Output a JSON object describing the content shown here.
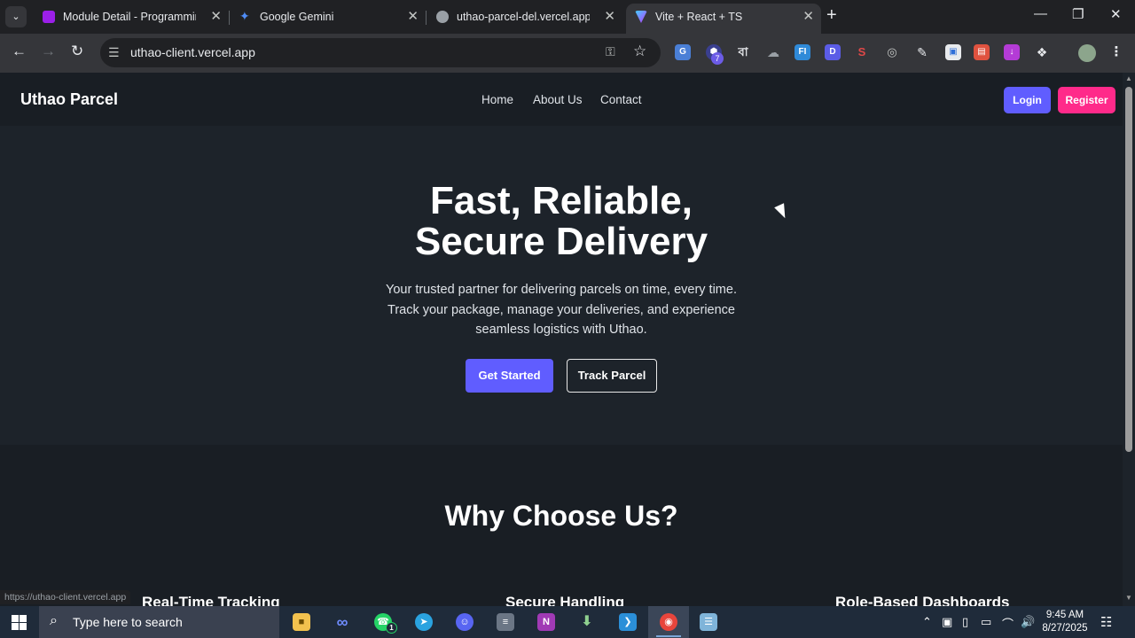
{
  "browser": {
    "tabs": [
      {
        "title": "Module Detail - Programming Hero",
        "favicon": "programming-hero-icon",
        "color": "#9b1fe8"
      },
      {
        "title": "Google Gemini",
        "favicon": "gemini-icon",
        "color": "#4f8cf6"
      },
      {
        "title": "uthao-parcel-del.vercel.app",
        "favicon": "globe-icon",
        "color": "#9aa0a6"
      },
      {
        "title": "Vite + React + TS",
        "favicon": "vite-icon",
        "color": "#b25cff"
      }
    ],
    "active_tab_index": 3,
    "url": "uthao-client.vercel.app",
    "status_url": "https://uthao-client.vercel.app",
    "extension_badge": "7"
  },
  "site": {
    "brand": "Uthao Parcel",
    "nav": [
      "Home",
      "About Us",
      "Contact"
    ],
    "login_label": "Login",
    "register_label": "Register",
    "hero": {
      "title_line1": "Fast, Reliable,",
      "title_line2": "Secure Delivery",
      "subtitle_line1": "Your trusted partner for delivering parcels on time, every time.",
      "subtitle_line2": "Track your package, manage your deliveries, and experience",
      "subtitle_line3": "seamless logistics with Uthao.",
      "primary_button": "Get Started",
      "secondary_button": "Track Parcel"
    },
    "why": {
      "title": "Why Choose Us?",
      "features": [
        "Real-Time Tracking",
        "Secure Handling",
        "Role-Based Dashboards"
      ]
    }
  },
  "taskbar": {
    "search_placeholder": "Type here to search",
    "whatsapp_badge": "1",
    "time": "9:45 AM",
    "date": "8/27/2025"
  },
  "colors": {
    "primary": "#605dff",
    "secondary": "#ff2a8a",
    "page_bg": "#1d232a",
    "navbar_bg": "#191e24"
  }
}
